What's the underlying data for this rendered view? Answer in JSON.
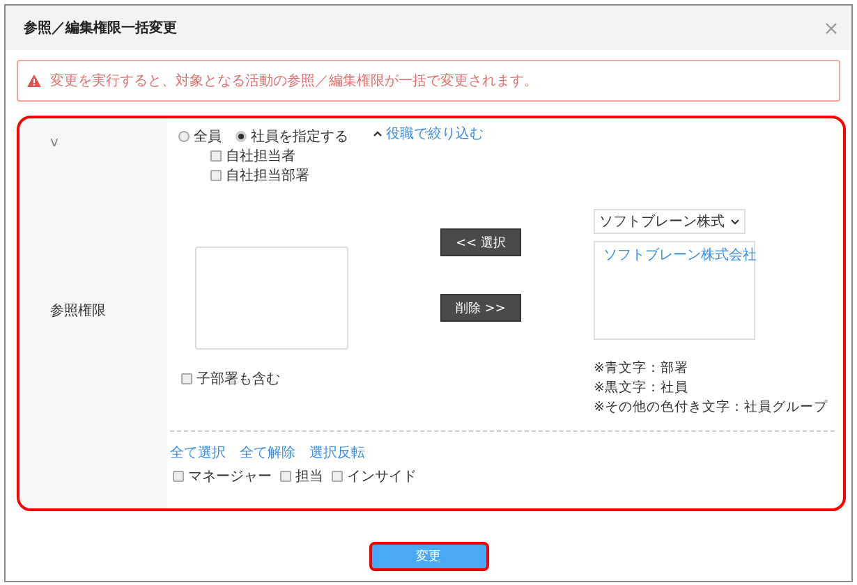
{
  "dialog": {
    "title": "参照／編集権限一括変更"
  },
  "alert": {
    "message": "変更を実行すると、対象となる活動の参照／編集権限が一括で変更されます。"
  },
  "form": {
    "marker": "v",
    "label": "参照権限",
    "scope_options": [
      {
        "label": "全員",
        "selected": false
      },
      {
        "label": "社員を指定する",
        "selected": true
      }
    ],
    "filter_link": "役職で絞り込む",
    "filter_expanded": true,
    "owner_options": [
      {
        "label": "自社担当者",
        "checked": false
      },
      {
        "label": "自社担当部署",
        "checked": false
      }
    ],
    "include_children": {
      "label": "子部署も含む",
      "checked": false
    },
    "add_button": "<< 選択",
    "remove_button": "削除 >>",
    "company_select": {
      "value": "ソフトブレーン株式"
    },
    "candidates": [
      {
        "label": "ソフトブレーン株式会社",
        "kind": "department"
      }
    ],
    "legend": [
      "※青文字：部署",
      "※黒文字：社員",
      "※その他の色付き文字：社員グループ"
    ],
    "bulk_links": [
      "全て選択",
      "全て解除",
      "選択反転"
    ],
    "roles": [
      {
        "label": "マネージャー",
        "checked": false
      },
      {
        "label": "担当",
        "checked": false
      },
      {
        "label": "インサイド",
        "checked": false
      }
    ]
  },
  "submit_button": "変更"
}
